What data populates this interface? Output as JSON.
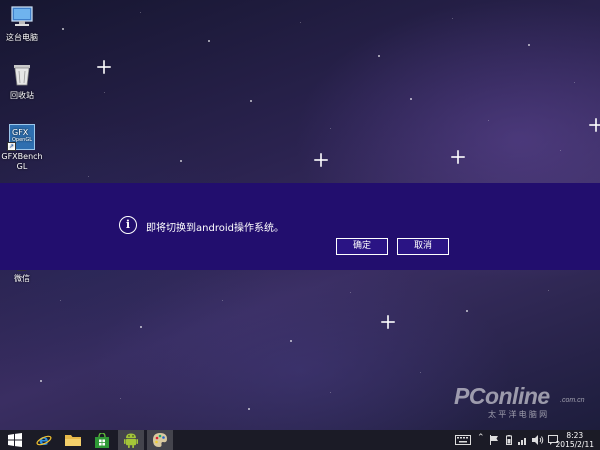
{
  "desktop": {
    "icons": [
      {
        "label": "这台电脑",
        "icon": "computer-icon"
      },
      {
        "label": "回收站",
        "icon": "recycle-bin-icon"
      },
      {
        "label_line1": "GFXBench",
        "label_line2": "GL",
        "icon": "gfxbench-icon",
        "icon_text1": "GFX",
        "icon_text2": "OpenGL"
      },
      {
        "label": "微信",
        "icon": "wechat-icon"
      }
    ]
  },
  "dialog": {
    "icon": "info-icon",
    "icon_glyph": "i",
    "message": "即将切换到android操作系统。",
    "ok_label": "确定",
    "cancel_label": "取消",
    "band_color": "#220e6e"
  },
  "watermark": {
    "brand": "PConline",
    "domain": ".com.cn",
    "slogan": "太 平 洋 电 脑 网"
  },
  "taskbar": {
    "items": [
      {
        "name": "start-button",
        "icon": "windows-logo-icon"
      },
      {
        "name": "internet-explorer",
        "icon": "ie-icon"
      },
      {
        "name": "file-explorer",
        "icon": "folder-icon"
      },
      {
        "name": "store",
        "icon": "store-icon"
      },
      {
        "name": "android",
        "icon": "android-icon",
        "active": true
      },
      {
        "name": "paint",
        "icon": "palette-icon",
        "active": true
      }
    ],
    "tray": {
      "icons": [
        "keyboard-icon",
        "flag-icon",
        "battery-icon",
        "network-icon",
        "volume-icon",
        "notification-icon"
      ],
      "time": "8:23",
      "date": "2015/2/11"
    }
  }
}
